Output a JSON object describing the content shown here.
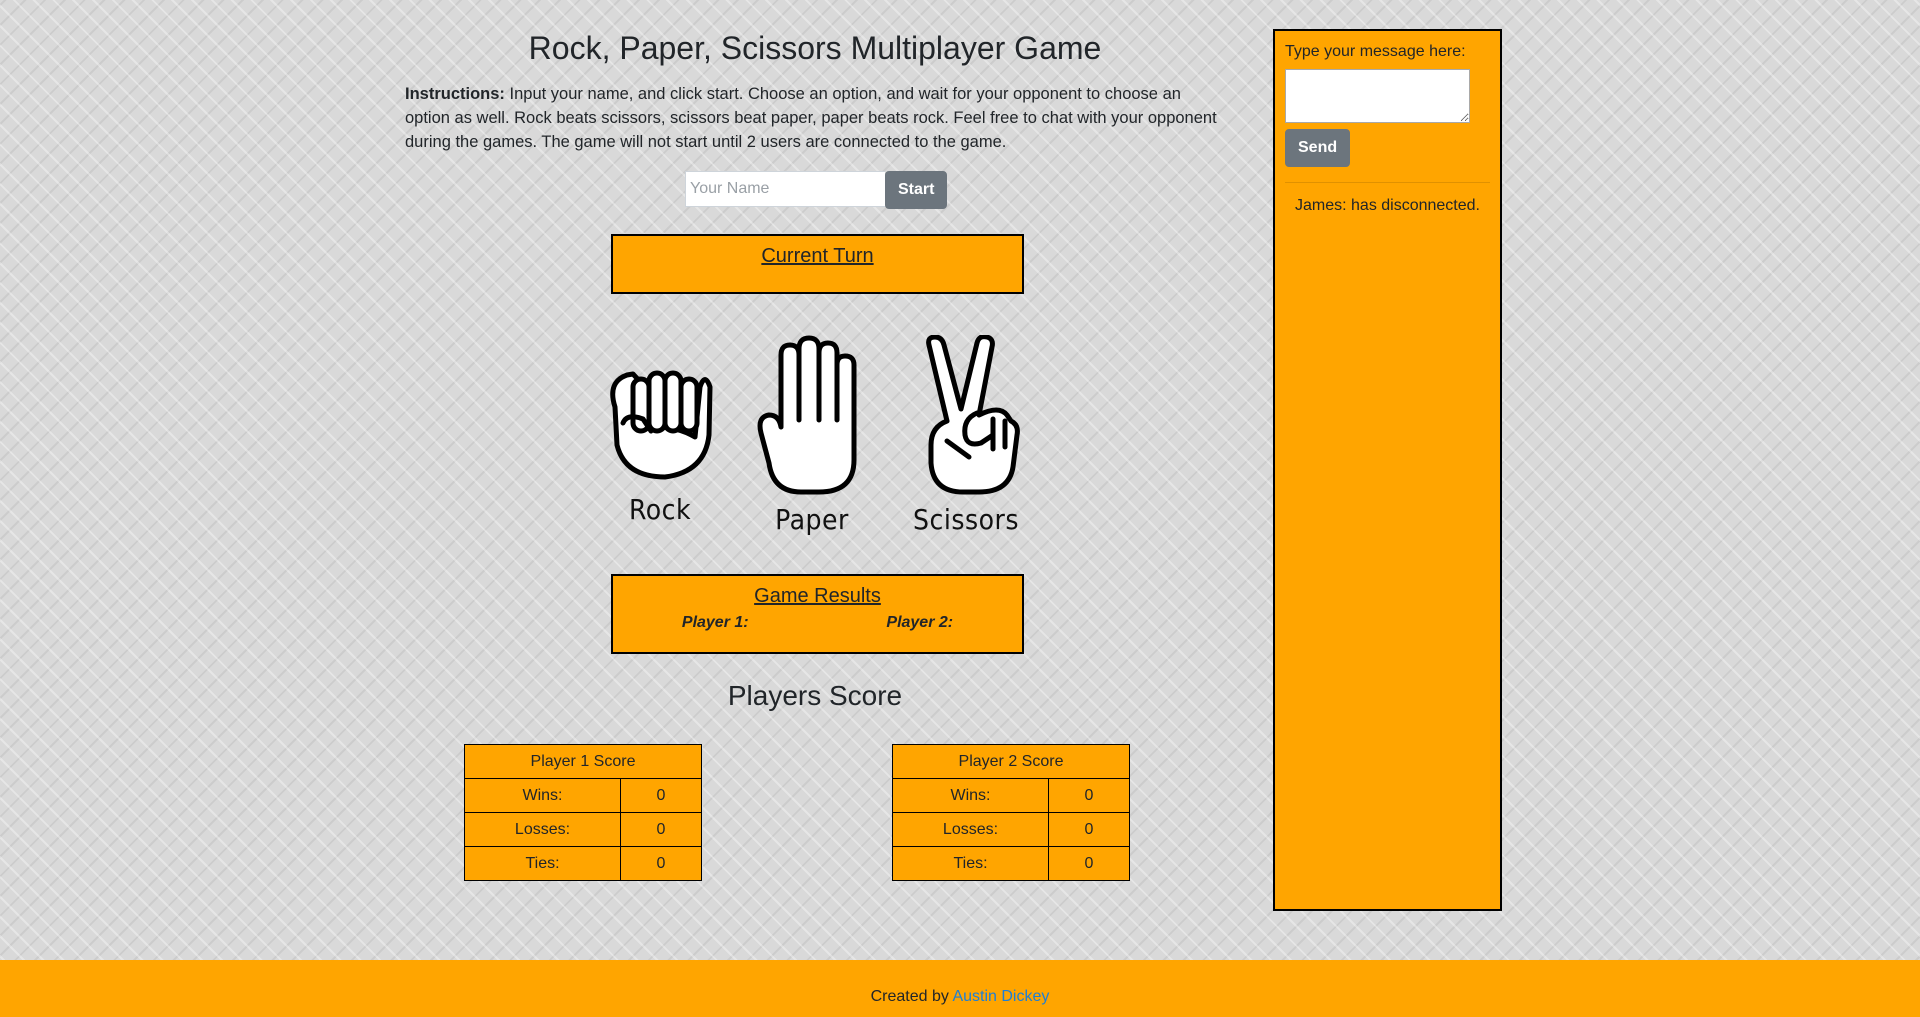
{
  "header": {
    "title": "Rock, Paper, Scissors Multiplayer Game",
    "instructions_label": "Instructions:",
    "instructions_text": " Input your name, and click start. Choose an option, and wait for your opponent to choose an option as well. Rock beats scissors, scissors beat paper, paper beats rock. Feel free to chat with your opponent during the games. The game will not start until 2 users are connected to the game."
  },
  "name_form": {
    "placeholder": "Your Name",
    "value": "",
    "start_label": "Start"
  },
  "current_turn": {
    "heading": "Current Turn",
    "text": ""
  },
  "choices": [
    {
      "label": "Rock",
      "icon": "rock-hand-icon"
    },
    {
      "label": "Paper",
      "icon": "paper-hand-icon"
    },
    {
      "label": "Scissors",
      "icon": "scissors-hand-icon"
    }
  ],
  "game_results": {
    "heading": "Game Results",
    "player1_label": "Player 1:",
    "player2_label": "Player 2:"
  },
  "scores": {
    "heading": "Players Score",
    "player1": {
      "title": "Player 1 Score",
      "rows": [
        {
          "label": "Wins:",
          "value": "0"
        },
        {
          "label": "Losses:",
          "value": "0"
        },
        {
          "label": "Ties:",
          "value": "0"
        }
      ]
    },
    "player2": {
      "title": "Player 2 Score",
      "rows": [
        {
          "label": "Wins:",
          "value": "0"
        },
        {
          "label": "Losses:",
          "value": "0"
        },
        {
          "label": "Ties:",
          "value": "0"
        }
      ]
    }
  },
  "chat": {
    "label": "Type your message here:",
    "message_value": "",
    "send_label": "Send",
    "messages": [
      "James: has disconnected."
    ]
  },
  "footer": {
    "prefix": "Created by ",
    "author": "Austin Dickey"
  },
  "colors": {
    "accent": "#ffa500",
    "button": "#6c757d",
    "link": "#1e7fd6"
  }
}
